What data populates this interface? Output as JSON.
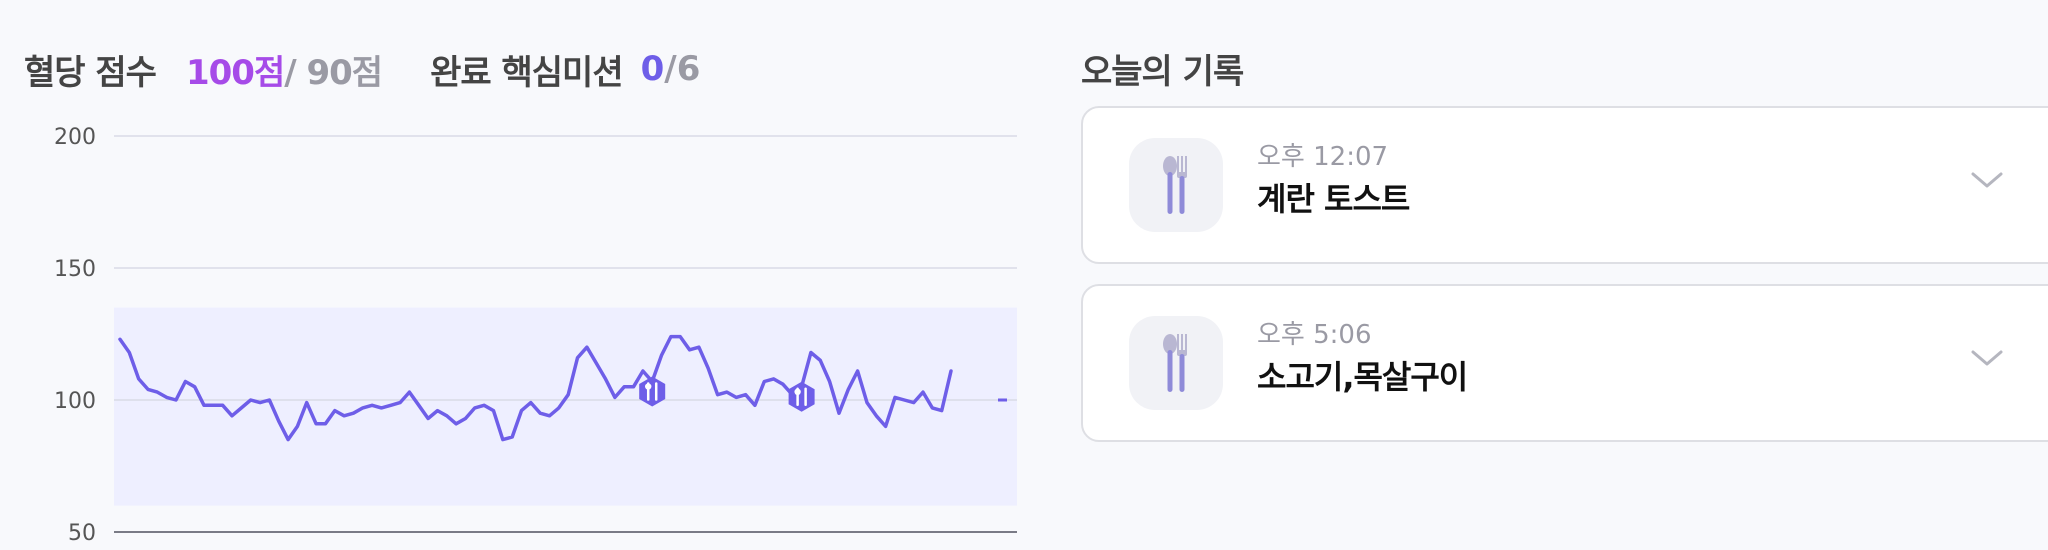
{
  "summary": {
    "score_label": "혈당 점수",
    "score_value": "100점",
    "score_target": "/ 90점",
    "mission_label": "완료 핵심미션",
    "mission_done": "0",
    "mission_total": "/6"
  },
  "chart_data": {
    "type": "line",
    "y_ticks": [
      "200",
      "150",
      "100",
      "50"
    ],
    "ylim": [
      50,
      200
    ],
    "target_range": [
      60,
      135
    ],
    "grid": true,
    "line_color": "#6e5ee8",
    "band_color": "#eeefff",
    "series": [
      {
        "values": [
          123,
          118,
          108,
          104,
          103,
          101,
          100,
          107,
          105,
          98,
          98,
          98,
          94,
          97,
          100,
          99,
          100,
          92,
          85,
          90,
          99,
          91,
          91,
          96,
          94,
          95,
          97,
          98,
          97,
          98,
          99,
          103,
          98,
          93,
          96,
          94,
          91,
          93,
          97,
          98,
          96,
          85,
          86,
          96,
          99,
          95,
          94,
          97,
          102,
          116,
          120,
          114,
          108,
          101,
          105,
          105,
          111,
          107,
          117,
          124,
          124,
          119,
          120,
          112,
          102,
          103,
          101,
          102,
          98,
          107,
          108,
          106,
          102,
          105,
          118,
          115,
          107,
          95,
          104,
          111,
          99,
          94,
          90,
          101,
          100,
          99,
          103,
          97,
          96,
          111
        ],
        "meal_markers": [
          57,
          73
        ]
      }
    ]
  },
  "records": {
    "title": "오늘의 기록",
    "items": [
      {
        "time": "오후 12:07",
        "name": "계란 토스트",
        "icon": "utensils-icon"
      },
      {
        "time": "오후 5:06",
        "name": "소고기,목살구이",
        "icon": "utensils-icon"
      }
    ]
  }
}
